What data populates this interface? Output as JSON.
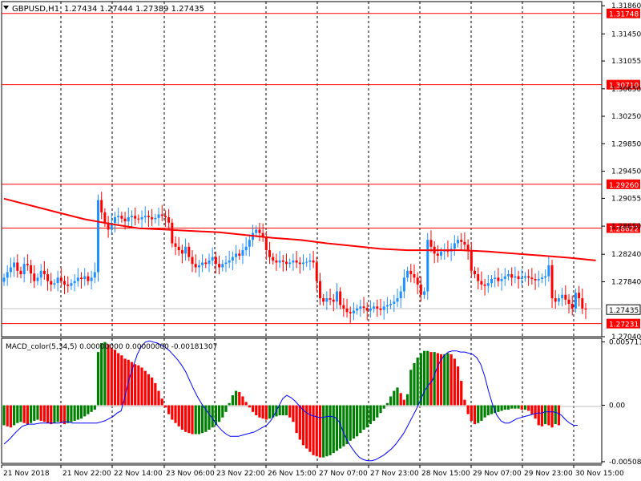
{
  "header": {
    "title": "GBPUSD,H1",
    "ohlc": "1.27434 1.27444 1.27389 1.27435"
  },
  "indicator": {
    "label": "MACD_color(5,34,5) 0.00000000 0.00000000 -0.00181307"
  },
  "colors": {
    "background": "#ffffff",
    "price_axis": "#000000",
    "bull": "#1e90ff",
    "bear": "#ff0000",
    "level_line": "#ff0000",
    "ma_line": "#ff0000",
    "hist_up": "#008000",
    "hist_down": "#ff0000",
    "signal": "#0000ff",
    "grid": "#000000"
  },
  "chart_data": [
    {
      "type": "candlestick",
      "symbol": "GBPUSD",
      "timeframe": "H1",
      "ylim": [
        1.2704,
        1.3192
      ],
      "y_ticks": [
        "1.31860",
        "1.31450",
        "1.31055",
        "1.30650",
        "1.30250",
        "1.29850",
        "1.29450",
        "1.29055",
        "1.28650",
        "1.28240",
        "1.27840",
        "1.27040"
      ],
      "y_tick_values": [
        1.3186,
        1.3145,
        1.31055,
        1.3065,
        1.3025,
        1.2985,
        1.2945,
        1.29055,
        1.2865,
        1.2824,
        1.2784,
        1.2704
      ],
      "x_labels": [
        "21 Nov 2018",
        "21 Nov 22:00",
        "22 Nov 14:00",
        "23 Nov 06:00",
        "23 Nov 22:00",
        "26 Nov 15:00",
        "27 Nov 07:00",
        "27 Nov 23:00",
        "28 Nov 15:00",
        "29 Nov 07:00",
        "29 Nov 23:00",
        "30 Nov 15:00"
      ],
      "levels": [
        {
          "label": "1.31748",
          "value": 1.31748
        },
        {
          "label": "1.30710",
          "value": 1.3071
        },
        {
          "label": "1.29260",
          "value": 1.2926
        },
        {
          "label": "1.28622",
          "value": 1.28622
        },
        {
          "label": "1.27231",
          "value": 1.27231
        }
      ],
      "current_price": {
        "label": "1.27435",
        "value": 1.27435
      },
      "closes": [
        1.279,
        1.2798,
        1.2805,
        1.2812,
        1.28,
        1.2795,
        1.281,
        1.2808,
        1.2796,
        1.2785,
        1.279,
        1.28,
        1.2795,
        1.2785,
        1.278,
        1.2782,
        1.279,
        1.2785,
        1.278,
        1.2778,
        1.2782,
        1.2785,
        1.279,
        1.2788,
        1.2792,
        1.2785,
        1.279,
        1.2798,
        1.2903,
        1.2885,
        1.287,
        1.286,
        1.287,
        1.2878,
        1.288,
        1.2876,
        1.2872,
        1.2878,
        1.288,
        1.2876,
        1.2875,
        1.2878,
        1.288,
        1.2878,
        1.2875,
        1.2877,
        1.2882,
        1.288,
        1.2878,
        1.287,
        1.284,
        1.2835,
        1.283,
        1.2825,
        1.2835,
        1.282,
        1.281,
        1.2805,
        1.2808,
        1.2812,
        1.281,
        1.2815,
        1.282,
        1.281,
        1.2805,
        1.281,
        1.2812,
        1.2815,
        1.282,
        1.2825,
        1.2822,
        1.283,
        1.2835,
        1.2845,
        1.2855,
        1.286,
        1.2855,
        1.285,
        1.283,
        1.282,
        1.2815,
        1.2812,
        1.2815,
        1.2813,
        1.281,
        1.2812,
        1.2815,
        1.2812,
        1.281,
        1.2812,
        1.2813,
        1.2815,
        1.2812,
        1.2785,
        1.276,
        1.2755,
        1.276,
        1.2758,
        1.2755,
        1.277,
        1.275,
        1.2745,
        1.274,
        1.2738,
        1.2742,
        1.2745,
        1.2748,
        1.2746,
        1.2742,
        1.2745,
        1.2748,
        1.2745,
        1.2743,
        1.2748,
        1.275,
        1.2752,
        1.2755,
        1.276,
        1.277,
        1.279,
        1.28,
        1.2795,
        1.279,
        1.278,
        1.2765,
        1.277,
        1.2845,
        1.2835,
        1.2825,
        1.2822,
        1.2828,
        1.283,
        1.2828,
        1.2832,
        1.284,
        1.2845,
        1.2842,
        1.2838,
        1.283,
        1.28,
        1.2795,
        1.2785,
        1.278,
        1.2778,
        1.2782,
        1.2788,
        1.279,
        1.2785,
        1.2788,
        1.2792,
        1.2795,
        1.279,
        1.2792,
        1.2788,
        1.279,
        1.2792,
        1.279,
        1.2788,
        1.2786,
        1.2788,
        1.279,
        1.2792,
        1.2808,
        1.276,
        1.2755,
        1.276,
        1.2765,
        1.2758,
        1.2752,
        1.2745,
        1.2768,
        1.276,
        1.2745,
        1.27435
      ],
      "ma": [
        1.2905,
        1.2895,
        1.2885,
        1.2875,
        1.2868,
        1.2862,
        1.286,
        1.2858,
        1.2856,
        1.2852,
        1.2848,
        1.2845,
        1.284,
        1.2836,
        1.2832,
        1.283,
        1.283,
        1.283,
        1.2828,
        1.2825,
        1.2822,
        1.2819,
        1.2815
      ],
      "ma_x": [
        0,
        8,
        16,
        24,
        32,
        40,
        48,
        56,
        64,
        72,
        80,
        88,
        96,
        104,
        112,
        120,
        128,
        136,
        144,
        152,
        160,
        168,
        176
      ]
    },
    {
      "type": "bar",
      "name": "MACD_color(5,34,5)",
      "ylim": [
        -0.005235,
        0.006036
      ],
      "y_ticks": [
        "0.005711",
        "0.00",
        "-0.005085"
      ],
      "y_tick_values": [
        0.005711,
        0.0,
        -0.005085
      ],
      "histogram": [
        -0.0018,
        -0.0019,
        -0.002,
        -0.0018,
        -0.0016,
        -0.0015,
        -0.0016,
        -0.0017,
        -0.0016,
        -0.0014,
        -0.0013,
        -0.0014,
        -0.0015,
        -0.0016,
        -0.0017,
        -0.0016,
        -0.0015,
        -0.0016,
        -0.0017,
        -0.0016,
        -0.0015,
        -0.0014,
        -0.0013,
        -0.0012,
        -0.001,
        -0.0008,
        -0.0006,
        -0.0004,
        0.0048,
        0.0056,
        0.0057,
        0.0055,
        0.0052,
        0.005,
        0.0047,
        0.0045,
        0.0042,
        0.0041,
        0.0039,
        0.0037,
        0.0036,
        0.0034,
        0.0031,
        0.0028,
        0.0025,
        0.002,
        0.0013,
        0.0006,
        -0.0002,
        -0.0008,
        -0.0013,
        -0.0016,
        -0.0019,
        -0.0022,
        -0.0024,
        -0.0025,
        -0.0026,
        -0.0026,
        -0.0026,
        -0.0025,
        -0.0024,
        -0.0022,
        -0.002,
        -0.0018,
        -0.0015,
        -0.0011,
        -0.0006,
        0.0002,
        0.0009,
        0.0013,
        0.0012,
        0.0008,
        0.0003,
        -0.0002,
        -0.0006,
        -0.0009,
        -0.0011,
        -0.0012,
        -0.0013,
        -0.0012,
        -0.0011,
        -0.001,
        -0.0009,
        -0.0009,
        -0.0009,
        -0.0011,
        -0.0015,
        -0.0025,
        -0.0031,
        -0.0036,
        -0.0039,
        -0.0042,
        -0.0045,
        -0.0046,
        -0.0047,
        -0.0047,
        -0.0046,
        -0.0045,
        -0.0043,
        -0.0041,
        -0.0039,
        -0.0037,
        -0.0035,
        -0.0032,
        -0.003,
        -0.0028,
        -0.0025,
        -0.0022,
        -0.002,
        -0.0017,
        -0.0014,
        -0.0011,
        -0.0007,
        -0.0003,
        0.0002,
        0.0008,
        0.0013,
        0.0016,
        0.0011,
        0.0005,
        0.001,
        0.0032,
        0.0038,
        0.0043,
        0.0047,
        0.0049,
        0.0049,
        0.0048,
        0.0048,
        0.0047,
        0.0046,
        0.0046,
        0.0047,
        0.0046,
        0.0042,
        0.0035,
        0.0022,
        0.0005,
        -0.0008,
        -0.0014,
        -0.0017,
        -0.0016,
        -0.0014,
        -0.0011,
        -0.0009,
        -0.0008,
        -0.0007,
        -0.0006,
        -0.0005,
        -0.0004,
        -0.0004,
        -0.0003,
        -0.0003,
        -0.0003,
        -0.0004,
        -0.0004,
        -0.0005,
        -0.0008,
        -0.0012,
        -0.0018,
        -0.0019,
        -0.0017,
        -0.0018,
        -0.002,
        -0.0017,
        -0.0018
      ],
      "signal": [
        -0.0035,
        -0.003,
        -0.0024,
        -0.0019,
        -0.0017,
        -0.0017,
        -0.0016,
        -0.0016,
        -0.0016,
        -0.0016,
        -0.0015,
        -0.0015,
        -0.0016,
        -0.0016,
        -0.0016,
        -0.0016,
        -0.0016,
        -0.0016,
        -0.0016,
        -0.0015,
        -0.0014,
        -0.0012,
        -0.001,
        -0.0007,
        -0.0005,
        0.0009,
        0.0024,
        0.0035,
        0.0046,
        0.0053,
        0.0057,
        0.0058,
        0.0057,
        0.0056,
        0.0054,
        0.0052,
        0.0049,
        0.0045,
        0.0041,
        0.0036,
        0.003,
        0.0022,
        0.0014,
        0.0007,
        0.0001,
        -0.0004,
        -0.0009,
        -0.0014,
        -0.0019,
        -0.0023,
        -0.0026,
        -0.0028,
        -0.0028,
        -0.0028,
        -0.0027,
        -0.0026,
        -0.0025,
        -0.0024,
        -0.0022,
        -0.002,
        -0.0018,
        -0.0014,
        -0.0008,
        -0.0001,
        0.0006,
        0.0009,
        0.0007,
        0.0004,
        0.0,
        -0.0004,
        -0.0007,
        -0.0009,
        -0.001,
        -0.0011,
        -0.0011,
        -0.001,
        -0.001,
        -0.0011,
        -0.0015,
        -0.0024,
        -0.0032,
        -0.0038,
        -0.0043,
        -0.0047,
        -0.0049,
        -0.005,
        -0.005,
        -0.0049,
        -0.0047,
        -0.0045,
        -0.0042,
        -0.0039,
        -0.0035,
        -0.003,
        -0.0025,
        -0.0018,
        -0.0011,
        -0.0004,
        0.0004,
        0.0012,
        0.0018,
        0.0022,
        0.0032,
        0.004,
        0.0045,
        0.0048,
        0.0049,
        0.0049,
        0.0048,
        0.0048,
        0.0047,
        0.0046,
        0.0043,
        0.0037,
        0.0026,
        0.0012,
        0.0,
        -0.0009,
        -0.0014,
        -0.0016,
        -0.0016,
        -0.0014,
        -0.0012,
        -0.0011,
        -0.001,
        -0.0009,
        -0.0008,
        -0.0007,
        -0.0007,
        -0.0006,
        -0.0006,
        -0.0006,
        -0.0007,
        -0.0009,
        -0.0013,
        -0.0016,
        -0.0018,
        -0.0018
      ],
      "signal_x": [
        0,
        3,
        6,
        9,
        12,
        15,
        18,
        21,
        24,
        27,
        30,
        32,
        34,
        36,
        38,
        40,
        42,
        44,
        46,
        48,
        50,
        52,
        54,
        56,
        58,
        60,
        62,
        64,
        66,
        68,
        70,
        72,
        74,
        76,
        78,
        80,
        82,
        84,
        86,
        88,
        90,
        92,
        94,
        96,
        98,
        100,
        102,
        104,
        106,
        108,
        110,
        112,
        114,
        116,
        118,
        120,
        122,
        124,
        126,
        128,
        130,
        132,
        134,
        136,
        138,
        140,
        142,
        144,
        146,
        148,
        150,
        152,
        154,
        156,
        158,
        160,
        162,
        164,
        166,
        168,
        170,
        172,
        174,
        176,
        178,
        180,
        182,
        184,
        186,
        188,
        190,
        192,
        194,
        196,
        198,
        200,
        202,
        204,
        206,
        208,
        210,
        212,
        214,
        216,
        218,
        220,
        222,
        224,
        226,
        228,
        230,
        232,
        234,
        236,
        238,
        240,
        242,
        244,
        246,
        248,
        250,
        252,
        254,
        256,
        258,
        260,
        262,
        264,
        266,
        268,
        270,
        272,
        274,
        276,
        278,
        280,
        282,
        284,
        286,
        288
      ]
    }
  ]
}
